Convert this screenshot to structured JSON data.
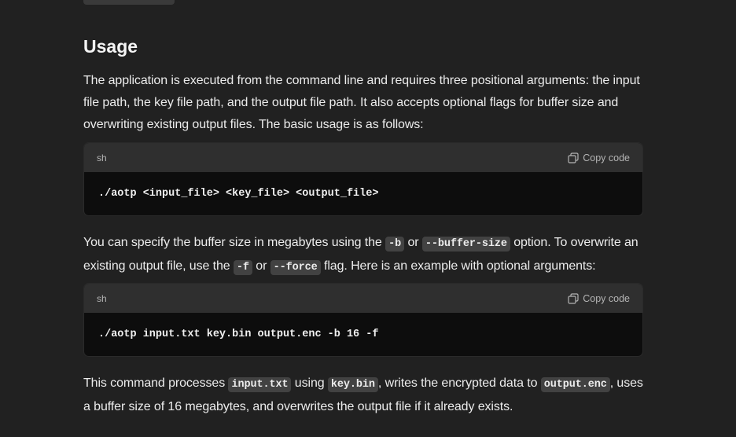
{
  "section": {
    "heading": "Usage"
  },
  "para1": {
    "text": "The application is executed from the command line and requires three positional arguments: the input file path, the key file path, and the output file path. It also accepts optional flags for buffer size and overwriting existing output files. The basic usage is as follows:"
  },
  "codeblock1": {
    "lang": "sh",
    "copy_label": "Copy code",
    "code": "./aotp <input_file> <key_file> <output_file>"
  },
  "para2": {
    "t1": "You can specify the buffer size in megabytes using the ",
    "c1": "-b",
    "t2": " or ",
    "c2": "--buffer-size",
    "t3": " option. To overwrite an existing output file, use the ",
    "c3": "-f",
    "t4": " or ",
    "c4": "--force",
    "t5": " flag. Here is an example with optional arguments:"
  },
  "codeblock2": {
    "lang": "sh",
    "copy_label": "Copy code",
    "code": "./aotp input.txt key.bin output.enc -b 16 -f"
  },
  "para3": {
    "t1": "This command processes ",
    "c1": "input.txt",
    "t2": " using ",
    "c2": "key.bin",
    "t3": ", writes the encrypted data to ",
    "c3": "output.enc",
    "t4": ", uses a buffer size of 16 megabytes, and overwrites the output file if it already exists."
  },
  "icons": {
    "copy": "copy-icon"
  },
  "colors": {
    "background": "#212121",
    "code_bg": "#0d0d0d",
    "code_header_bg": "#2f2f2f",
    "inline_code_bg": "#424242",
    "text": "#ececec"
  }
}
